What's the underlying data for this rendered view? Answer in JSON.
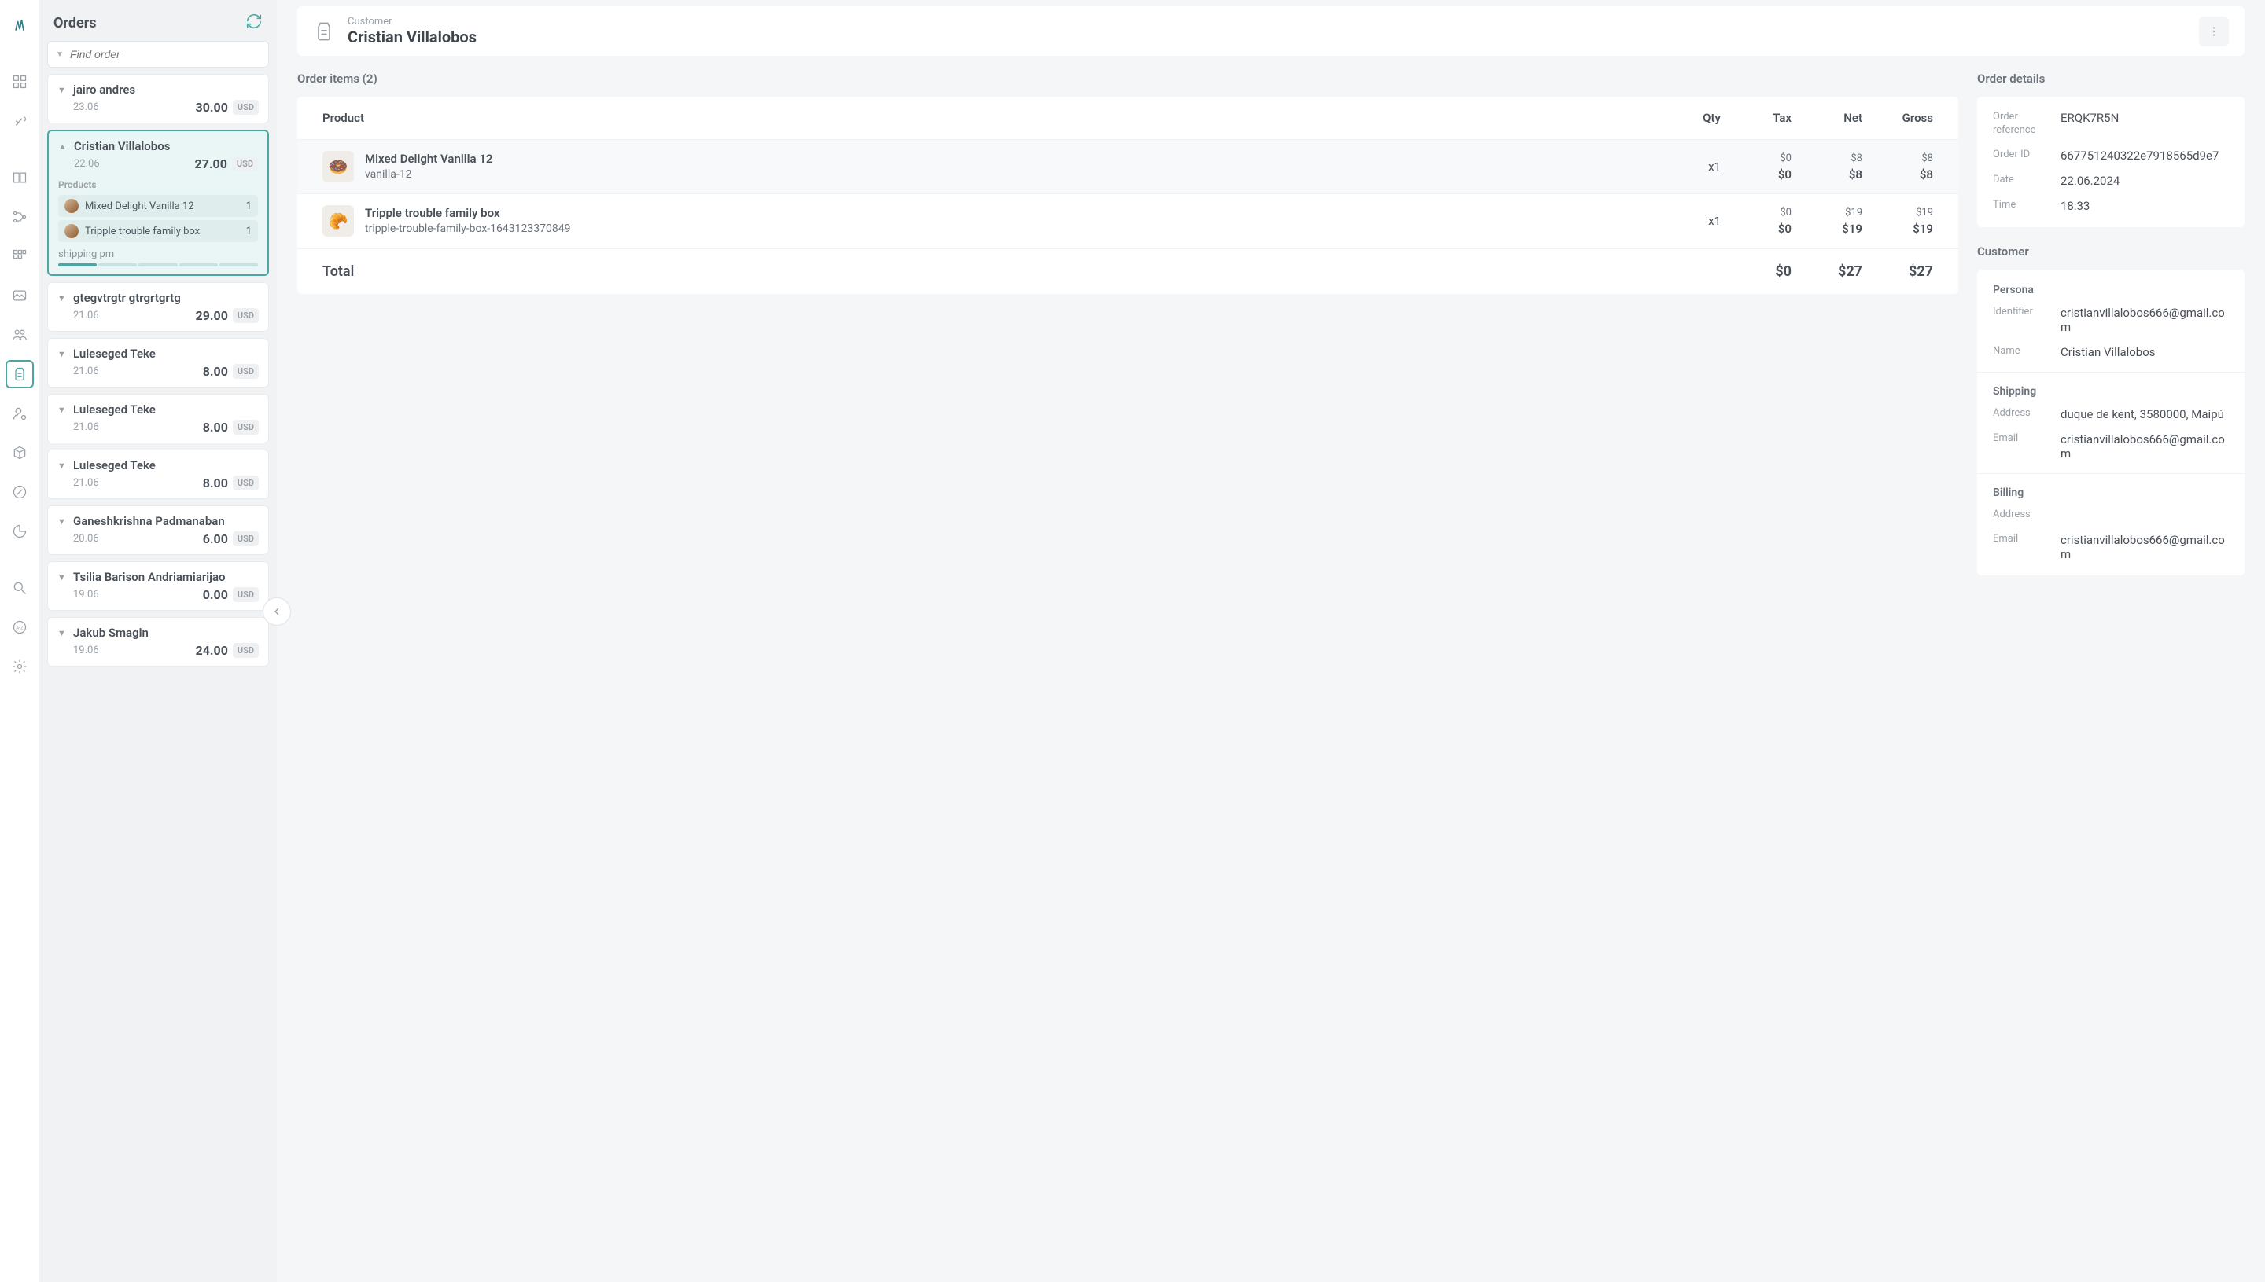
{
  "sidebar_title": "Orders",
  "search_placeholder": "Find order",
  "orders": [
    {
      "name": "jairo andres",
      "date": "23.06",
      "amount": "30.00",
      "currency": "USD"
    },
    {
      "name": "Cristian Villalobos",
      "date": "22.06",
      "amount": "27.00",
      "currency": "USD",
      "selected": true,
      "products_label": "Products",
      "products": [
        {
          "name": "Mixed Delight Vanilla 12",
          "qty": "1"
        },
        {
          "name": "Tripple trouble family box",
          "qty": "1"
        }
      ],
      "shipping_label": "shipping pm"
    },
    {
      "name": "gtegvtrgtr gtrgrtgrtg",
      "date": "21.06",
      "amount": "29.00",
      "currency": "USD"
    },
    {
      "name": "Luleseged Teke",
      "date": "21.06",
      "amount": "8.00",
      "currency": "USD"
    },
    {
      "name": "Luleseged Teke",
      "date": "21.06",
      "amount": "8.00",
      "currency": "USD"
    },
    {
      "name": "Luleseged Teke",
      "date": "21.06",
      "amount": "8.00",
      "currency": "USD"
    },
    {
      "name": "Ganeshkrishna Padmanaban",
      "date": "20.06",
      "amount": "6.00",
      "currency": "USD"
    },
    {
      "name": "Tsilia Barison Andriamiarijao",
      "date": "19.06",
      "amount": "0.00",
      "currency": "USD"
    },
    {
      "name": "Jakub Smagin",
      "date": "19.06",
      "amount": "24.00",
      "currency": "USD"
    }
  ],
  "header": {
    "sup": "Customer",
    "title": "Cristian Villalobos"
  },
  "items": {
    "title": "Order items (2)",
    "columns": {
      "product": "Product",
      "qty": "Qty",
      "tax": "Tax",
      "net": "Net",
      "gross": "Gross"
    },
    "rows": [
      {
        "name": "Mixed Delight Vanilla 12",
        "sku": "vanilla-12",
        "qty": "x1",
        "tax1": "$0",
        "tax2": "$0",
        "net1": "$8",
        "net2": "$8",
        "gross1": "$8",
        "gross2": "$8",
        "emoji": "🍩"
      },
      {
        "name": "Tripple trouble family box",
        "sku": "tripple-trouble-family-box-1643123370849",
        "qty": "x1",
        "tax1": "$0",
        "tax2": "$0",
        "net1": "$19",
        "net2": "$19",
        "gross1": "$19",
        "gross2": "$19",
        "emoji": "🥐"
      }
    ],
    "total": {
      "label": "Total",
      "tax": "$0",
      "net": "$27",
      "gross": "$27"
    }
  },
  "details": {
    "title": "Order details",
    "rows": [
      {
        "k": "Order reference",
        "v": "ERQK7R5N"
      },
      {
        "k": "Order ID",
        "v": "667751240322e7918565d9e7"
      },
      {
        "k": "Date",
        "v": "22.06.2024"
      },
      {
        "k": "Time",
        "v": "18:33"
      }
    ]
  },
  "customer": {
    "title": "Customer",
    "persona": {
      "title": "Persona",
      "rows": [
        {
          "k": "Identifier",
          "v": "cristianvillalobos666@gmail.com"
        },
        {
          "k": "Name",
          "v": "Cristian Villalobos"
        }
      ]
    },
    "shipping": {
      "title": "Shipping",
      "rows": [
        {
          "k": "Address",
          "v": "duque de kent, 3580000, Maipú"
        },
        {
          "k": "Email",
          "v": "cristianvillalobos666@gmail.com"
        }
      ]
    },
    "billing": {
      "title": "Billing",
      "rows": [
        {
          "k": "Address",
          "v": ""
        },
        {
          "k": "Email",
          "v": "cristianvillalobos666@gmail.com"
        }
      ]
    }
  }
}
